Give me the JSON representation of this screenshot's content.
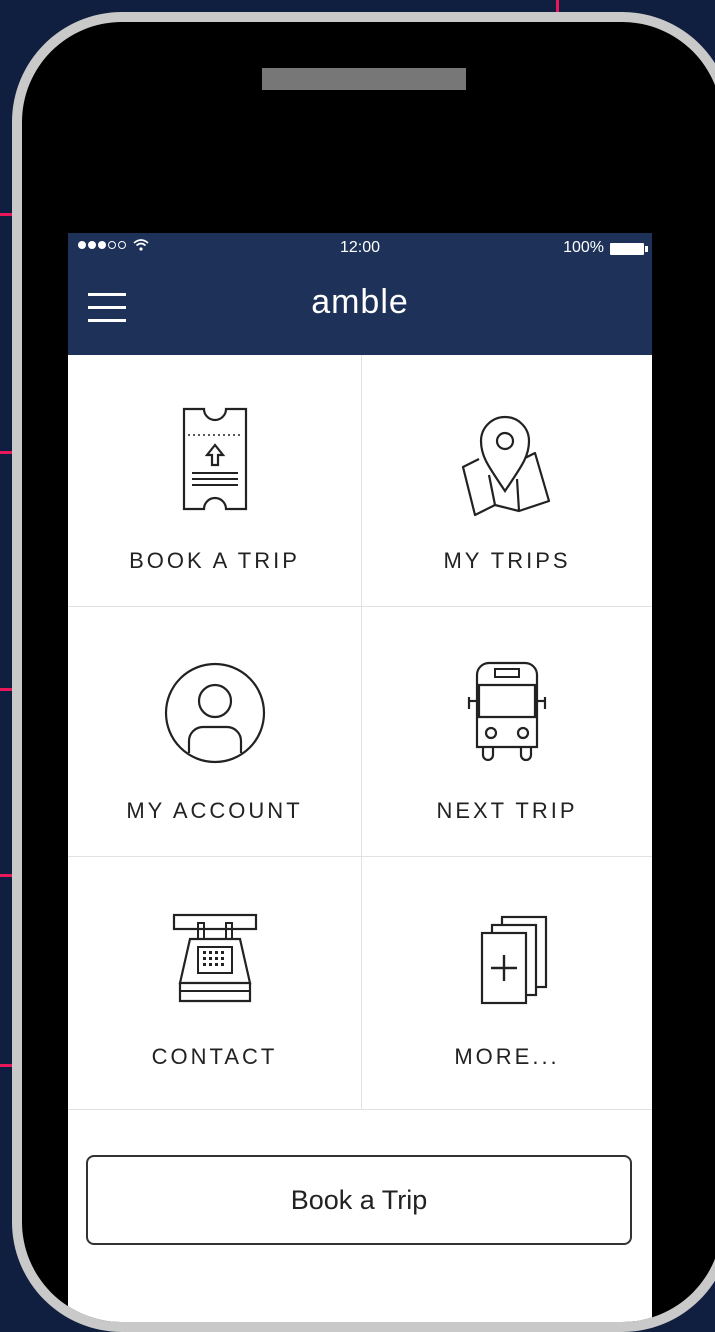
{
  "status_bar": {
    "time": "12:00",
    "battery": "100%",
    "signal_icon": "signal-dots-icon",
    "wifi_icon": "wifi-icon",
    "battery_icon": "battery-icon"
  },
  "app_bar": {
    "title": "amble",
    "menu_icon": "hamburger-menu-icon"
  },
  "tiles": [
    {
      "label": "BOOK A TRIP",
      "icon": "ticket-icon"
    },
    {
      "label": "MY TRIPS",
      "icon": "map-pin-icon"
    },
    {
      "label": "MY ACCOUNT",
      "icon": "user-icon"
    },
    {
      "label": "NEXT TRIP",
      "icon": "bus-icon"
    },
    {
      "label": "CONTACT",
      "icon": "telephone-icon"
    },
    {
      "label": "MORE...",
      "icon": "add-pages-icon"
    }
  ],
  "primary_button": {
    "label": "Book a Trip"
  },
  "colors": {
    "background": "#101f3f",
    "header": "#1d3159",
    "accent_lines": "#e8185a",
    "bezel": "#c9c9c9"
  }
}
